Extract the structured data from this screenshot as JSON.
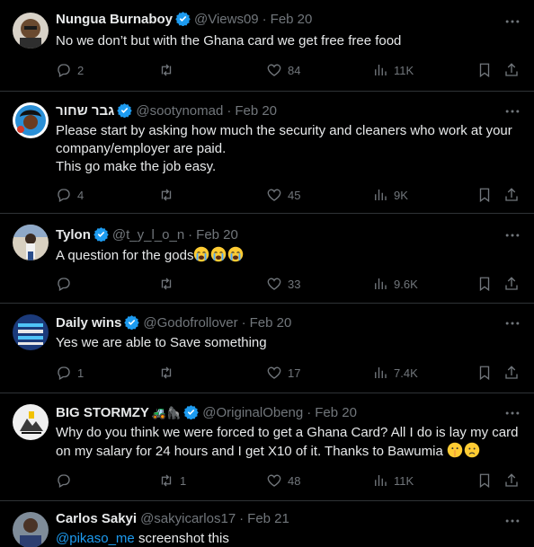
{
  "tweets": [
    {
      "name": "Nungua Burnaboy",
      "handle": "@Views09",
      "date": "Feb 20",
      "text": "No we don’t but with the Ghana card we get free free food",
      "replies": "2",
      "retweets": "",
      "likes": "84",
      "views": "11K",
      "avatar_color": "#8b6b4a"
    },
    {
      "name": "גבר שחור",
      "handle": "@sootynomad",
      "date": "Feb 20",
      "text": "Please start by asking how much the security and cleaners who work at your company/employer are paid.\nThis go make the job easy.",
      "replies": "4",
      "retweets": "",
      "likes": "45",
      "views": "9K",
      "avatar_color": "#2a8fd6"
    },
    {
      "name": "Tylon",
      "handle": "@t_y_l_o_n",
      "date": "Feb 20",
      "text": "A question for the gods",
      "replies": "",
      "retweets": "",
      "likes": "33",
      "views": "9.6K",
      "avatar_color": "#c9c2b5"
    },
    {
      "name": "Daily wins",
      "handle": "@Godofrollover",
      "date": "Feb 20",
      "text": "Yes we are able to Save something",
      "replies": "1",
      "retweets": "",
      "likes": "17",
      "views": "7.4K",
      "avatar_color": "#1b3a7a"
    },
    {
      "name": "BIG STORMZY",
      "handle": "@OriginalObeng",
      "date": "Feb 20",
      "text": "Why do you think we were forced to get a Ghana Card? All I do is lay my card on my salary for 24 hours and I get X10 of it. Thanks to Bawumia",
      "replies": "",
      "retweets": "1",
      "likes": "48",
      "views": "11K",
      "avatar_color": "#e8e8e8"
    },
    {
      "name": "Carlos Sakyi",
      "handle": "@sakyicarlos17",
      "date": "Feb 21",
      "mention": "@pikaso_me",
      "text": " screenshot this",
      "avatar_color": "#6f7f8f"
    }
  ],
  "colors": {
    "background": "#000000",
    "text": "#e7e9ea",
    "muted": "#71767b",
    "accent": "#1d9bf0",
    "divider": "#2f3336"
  },
  "icons": [
    "reply-icon",
    "retweet-icon",
    "like-icon",
    "views-icon",
    "bookmark-icon",
    "share-icon",
    "more-icon",
    "verified-icon"
  ]
}
